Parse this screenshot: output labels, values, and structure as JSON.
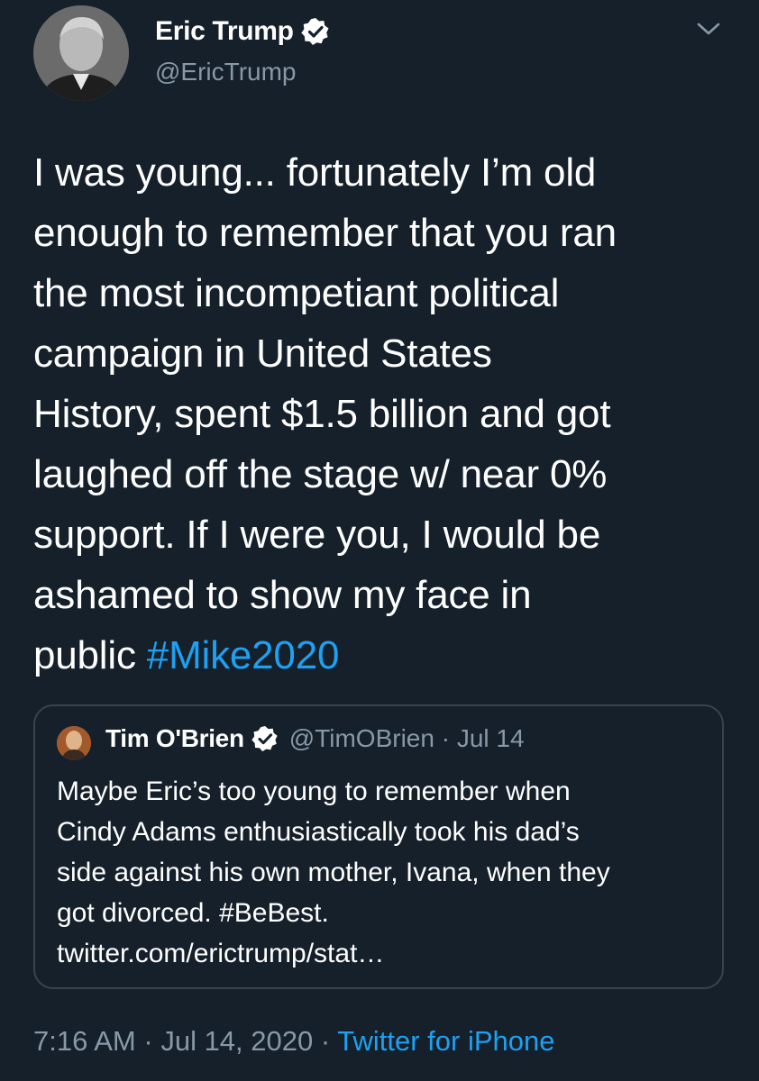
{
  "tweet": {
    "display_name": "Eric Trump",
    "handle": "@EricTrump",
    "text": "I was young... fortunately I’m old\nenough to remember that you ran\nthe most incompetiant political\ncampaign in United States\nHistory, spent $1.5 billion and got\nlaughed off the stage w/ near 0%\nsupport. If I were you, I would be\nashamed to show my face in\npublic ",
    "hashtag": "#Mike2020",
    "time": "7:16 AM",
    "date": "Jul 14, 2020",
    "separator": "·",
    "source": "Twitter for iPhone"
  },
  "quoted": {
    "display_name": "Tim O'Brien",
    "meta": "@TimOBrien · Jul 14",
    "text": "Maybe Eric’s too young to remember when\nCindy Adams enthusiastically took his dad’s\nside against his own mother, Ivana, when they\ngot divorced. #BeBest.\ntwitter.com/erictrump/stat…"
  },
  "icons": {
    "verified": "verified-badge-icon",
    "menu": "chevron-down-icon"
  },
  "colors": {
    "background": "#15202b",
    "text": "#ffffff",
    "muted": "#8899a6",
    "link": "#1da1f2",
    "border": "#38444d"
  }
}
